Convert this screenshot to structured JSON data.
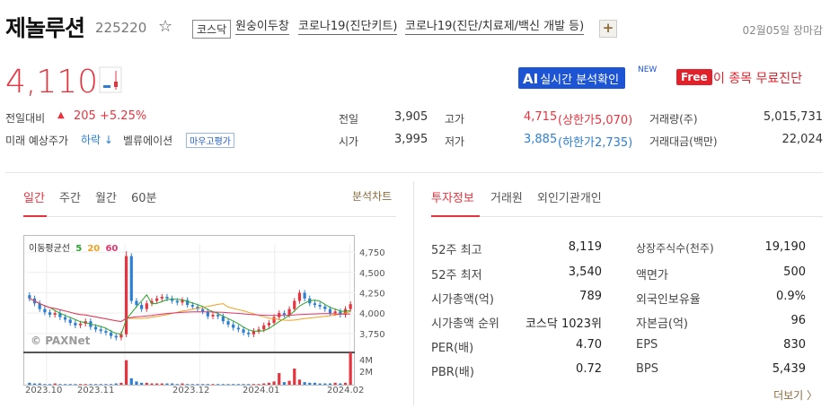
{
  "header": {
    "stock_name": "제놀루션",
    "stock_code": "225220",
    "star_icon": "star-outline-icon",
    "market": "코스닥",
    "themes": [
      "원숭이두창",
      "코로나19(진단키트)",
      "코로나19(진단/치료제/백신 개발 등)"
    ],
    "plus_label": "+",
    "date_status": "02월05일 장마감"
  },
  "price": {
    "current": "4,110",
    "change_label": "전일대비",
    "change_arrow": "▲",
    "change_value": "205",
    "change_pct": "+5.25%",
    "forecast_label": "미래 예상주가",
    "forecast_value": "하락 ↓",
    "valuation_label": "벨류에이션",
    "valuation_badge": "마우고평가"
  },
  "buttons": {
    "ai_prefix": "AI",
    "ai_label": "실시간 분석확인",
    "new_tag": "NEW",
    "free_tag": "Free",
    "free_label": "이 종목 무료진단"
  },
  "quote": {
    "prev_close_label": "전일",
    "prev_close": "3,905",
    "open_label": "시가",
    "open": "3,995",
    "high_label": "고가",
    "high": "4,715",
    "high_limit": "(상한가5,070)",
    "low_label": "저가",
    "low": "3,885",
    "low_limit": "(하한가2,735)",
    "volume_label": "거래량(주)",
    "volume": "5,015,731",
    "amount_label": "거래대금(백만)",
    "amount": "22,024"
  },
  "chart_tabs": [
    "일간",
    "주간",
    "월간",
    "60분"
  ],
  "analysis_link": "분석차트",
  "info_tabs": [
    "투자정보",
    "거래원",
    "외인기관개인"
  ],
  "chart_data": {
    "type": "candlestick",
    "ma_label": "이동평균선",
    "ma_periods": [
      "5",
      "20",
      "60"
    ],
    "ma_colors": [
      "#2aa52a",
      "#f0a020",
      "#e0366c"
    ],
    "watermark": "PAXNet",
    "y_ticks": [
      "4,750",
      "4,500",
      "4,250",
      "4,000",
      "3,750"
    ],
    "ylim": [
      3550,
      4850
    ],
    "volume_ticks": [
      "4M",
      "2M"
    ],
    "x_ticks": [
      "2023.10",
      "2023.11",
      "2023.12",
      "2024.01",
      "2024.02"
    ],
    "closes": [
      4180,
      4120,
      4050,
      4010,
      3980,
      4000,
      3950,
      3920,
      3880,
      3850,
      3870,
      3900,
      3830,
      3800,
      3780,
      3760,
      3720,
      3700,
      3740,
      4700,
      4150,
      4100,
      4050,
      4120,
      4150,
      4180,
      4200,
      4180,
      4150,
      4130,
      4160,
      4100,
      4080,
      4050,
      4020,
      3960,
      3980,
      3960,
      3900,
      3860,
      3820,
      3800,
      3760,
      3740,
      3780,
      3800,
      3850,
      3880,
      3950,
      4000,
      3980,
      4050,
      4150,
      4250,
      4180,
      4120,
      4100,
      4080,
      4050,
      4000,
      4020,
      3980,
      4050,
      4110
    ],
    "volumes": [
      0.3,
      0.2,
      0.2,
      0.1,
      0.1,
      0.2,
      0.1,
      0.1,
      0.1,
      0.1,
      0.1,
      0.1,
      0.1,
      0.1,
      0.1,
      0.1,
      0.1,
      0.2,
      0.3,
      3.8,
      1.0,
      0.5,
      0.3,
      0.3,
      0.2,
      0.2,
      0.2,
      0.2,
      0.2,
      0.1,
      0.2,
      0.1,
      0.1,
      0.1,
      0.1,
      0.1,
      0.1,
      0.1,
      0.1,
      0.1,
      0.1,
      0.1,
      0.1,
      0.1,
      0.1,
      0.1,
      0.2,
      0.3,
      0.5,
      1.8,
      0.4,
      0.6,
      2.5,
      0.8,
      0.4,
      0.3,
      0.3,
      0.2,
      0.2,
      0.2,
      0.3,
      0.2,
      0.3,
      5.0
    ]
  },
  "invest": {
    "left": [
      {
        "label": "52주 최고",
        "value": "8,119"
      },
      {
        "label": "52주 최저",
        "value": "3,540"
      },
      {
        "label": "시가총액(억)",
        "value": "789"
      },
      {
        "label": "시가총액 순위",
        "value": "코스닥 1023위"
      },
      {
        "label": "PER(배)",
        "value": "4.70"
      },
      {
        "label": "PBR(배)",
        "value": "0.72"
      }
    ],
    "right": [
      {
        "label": "상장주식수(천주)",
        "value": "19,190"
      },
      {
        "label": "액면가",
        "value": "500"
      },
      {
        "label": "외국인보유율",
        "value": "0.9%"
      },
      {
        "label": "자본금(억)",
        "value": "96"
      },
      {
        "label": "EPS",
        "value": "830"
      },
      {
        "label": "BPS",
        "value": "5,439"
      }
    ],
    "more_label": "더보기 〉"
  }
}
